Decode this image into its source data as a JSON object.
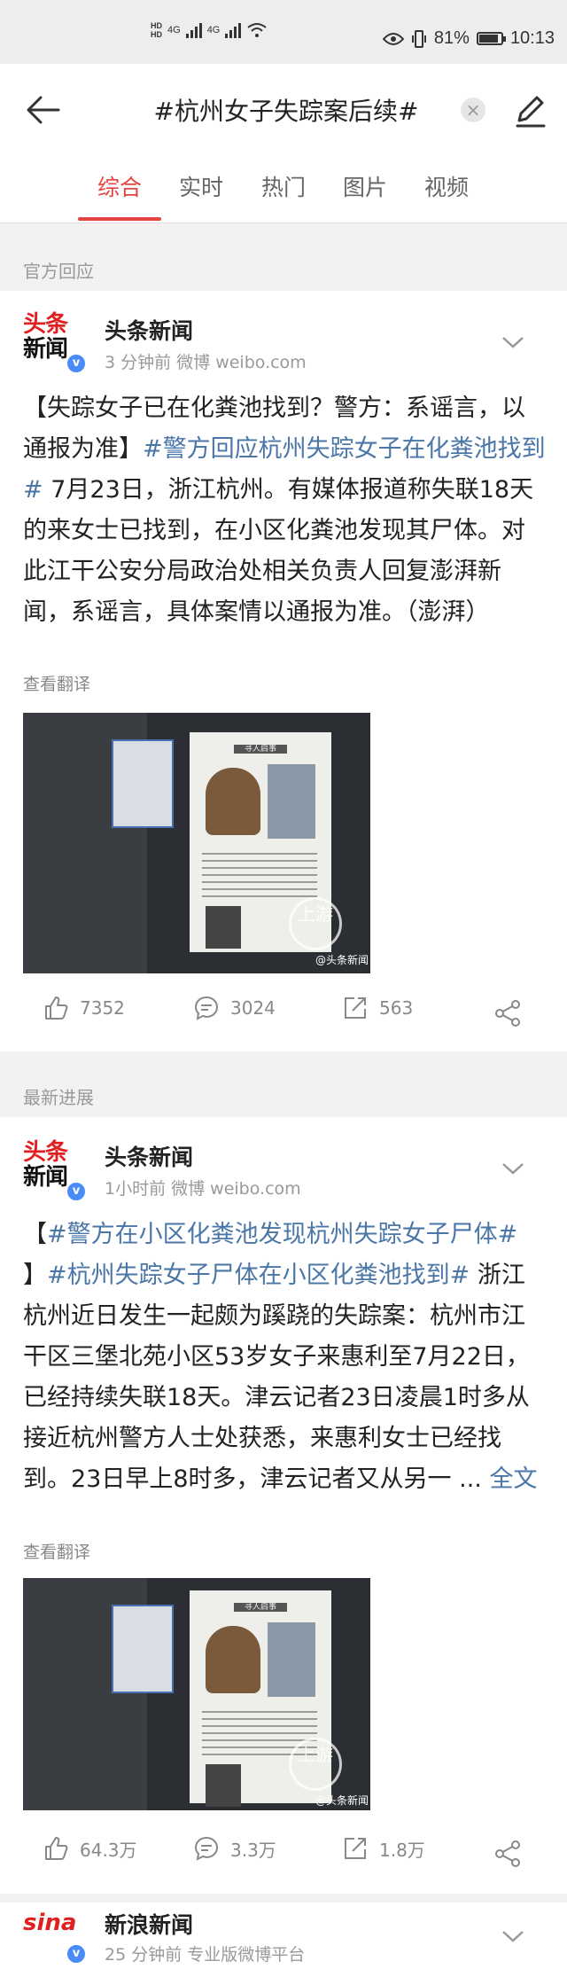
{
  "status_bar": {
    "hd1": "HD",
    "hd2": "HD",
    "net1": "4G",
    "net2": "4G",
    "battery_pct": "81%",
    "time": "10:13"
  },
  "header": {
    "title": "#杭州女子失踪案后续#",
    "clear_glyph": "×"
  },
  "tabs": [
    "综合",
    "实时",
    "热门",
    "图片",
    "视频"
  ],
  "sections": {
    "official": "官方回应",
    "latest": "最新进展"
  },
  "post1": {
    "logo_top": "头条",
    "logo_bottom": "新闻",
    "author": "头条新闻",
    "meta": "3 分钟前   微博 weibo.com",
    "text_a": "【失踪女子已在化粪池找到？警方：系谣言，以通报为准】",
    "tag": "#警方回应杭州失踪女子在化粪池找到#",
    "text_b": " 7月23日，浙江杭州。有媒体报道称失联18天的来女士已找到，在小区化粪池发现其尸体。对此江干公安分局政治处相关负责人回复澎湃新闻，系谣言，具体案情以通报为准。（澎湃）",
    "translate": "查看翻译",
    "photo_title": "寻人启事",
    "photo_mark": "上游",
    "photo_wm": "@头条新闻",
    "likes": "7352",
    "comments": "3024",
    "reposts": "563"
  },
  "post2": {
    "logo_top": "头条",
    "logo_bottom": "新闻",
    "author": "头条新闻",
    "meta": "1小时前   微博 weibo.com",
    "text_a": "【",
    "tag1": "#警方在小区化粪池发现杭州失踪女子尸体#",
    "text_b": " 】",
    "tag2": "#杭州失踪女子尸体在小区化粪池找到#",
    "text_c": " 浙江杭州近日发生一起颇为蹊跷的失踪案：杭州市江干区三堡北苑小区53岁女子来惠利至7月22日，已经持续失联18天。津云记者23日凌晨1时多从接近杭州警方人士处获悉，来惠利女士已经找到。23日早上8时多，津云记者又从另一 ... ",
    "more": "全文",
    "translate": "查看翻译",
    "photo_title": "寻人启事",
    "photo_mark": "上游",
    "photo_wm": "@头条新闻",
    "likes": "64.3万",
    "comments": "3.3万",
    "reposts": "1.8万"
  },
  "post3": {
    "logo": "sina",
    "author": "新浪新闻",
    "meta": "25 分钟前   专业版微博平台"
  },
  "colors": {
    "accent": "#e64340",
    "link": "#4a76a8",
    "verified": "#4a8cf7"
  }
}
